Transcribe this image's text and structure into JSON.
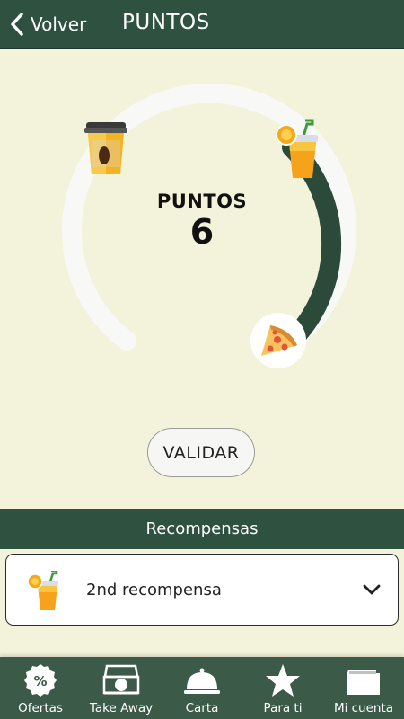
{
  "header": {
    "back_label": "Volver",
    "title": "PUNTOS"
  },
  "points": {
    "label": "PUNTOS",
    "value": "6",
    "progress_fraction": 0.34
  },
  "validate_button": "VALIDAR",
  "rewards": {
    "section_title": "Recompensas",
    "items": [
      {
        "label": "2nd recompensa",
        "icon": "juice-icon"
      }
    ]
  },
  "nav": [
    {
      "label": "Ofertas",
      "icon": "percent-badge-icon"
    },
    {
      "label": "Take Away",
      "icon": "pizza-box-icon"
    },
    {
      "label": "Carta",
      "icon": "cloche-icon"
    },
    {
      "label": "Para ti",
      "icon": "star-icon"
    },
    {
      "label": "Mi cuenta",
      "icon": "card-icon"
    }
  ],
  "colors": {
    "primary": "#2f5240",
    "background": "#f3f2da",
    "progress": "#2c4a3a",
    "track": "#f7f7f5"
  }
}
